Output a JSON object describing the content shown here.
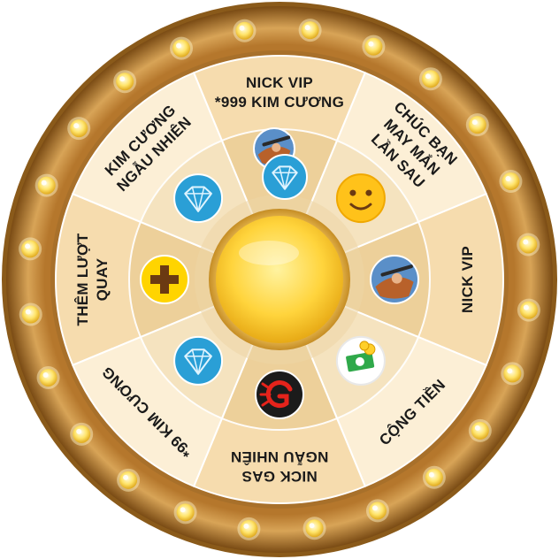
{
  "wheel": {
    "segments": [
      {
        "id": "them-luot-quay",
        "lines": [
          "THÊM LƯỢT",
          "QUAY"
        ],
        "icon": "plus-icon",
        "label_flip": false
      },
      {
        "id": "kim-cuong-ngau-nhien",
        "lines": [
          "KIM CƯƠNG",
          "NGẪU NHIÊN"
        ],
        "icon": "diamond-icon",
        "label_flip": false
      },
      {
        "id": "nick-vip-999",
        "lines": [
          "NICK VIP",
          "*999 KIM CƯƠNG"
        ],
        "icon": "character-diamond-icon",
        "label_flip": false
      },
      {
        "id": "chuc-ban-may-man",
        "lines": [
          "CHÚC BẠN",
          "MAY MẮN",
          "LẦN SAU"
        ],
        "icon": "smiley-icon",
        "label_flip": false
      },
      {
        "id": "nick-vip",
        "lines": [
          "NICK VIP"
        ],
        "icon": "character-icon",
        "label_flip": true
      },
      {
        "id": "cong-tien",
        "lines": [
          "CỘNG TIỀN"
        ],
        "icon": "money-icon",
        "label_flip": true
      },
      {
        "id": "nick-gas-ngau-nhien",
        "lines": [
          "NICK GAS",
          "NGẪU NHIÊN"
        ],
        "icon": "garena-icon",
        "label_flip": false
      },
      {
        "id": "99-kim-cuong",
        "lines": [
          "*99 KIM CƯƠNG"
        ],
        "icon": "diamond-icon",
        "label_flip": false
      }
    ]
  },
  "colors": {
    "rim_outer": "#8a5a1a",
    "rim_mid": "#c08a3e",
    "rim_inner": "#a8702a",
    "segment_dark": "#f6dcae",
    "segment_light": "#fcefd6",
    "inner_ring": "#edd2a2",
    "bulb": "#ffe46a",
    "hub": "#ffd43c",
    "diamond_bg": "#2a9fd6",
    "plus_bg": "#ffd400",
    "smiley": "#ffc21a",
    "money_bg": "#2fa94a",
    "garena_bg": "#1b1b1b"
  }
}
